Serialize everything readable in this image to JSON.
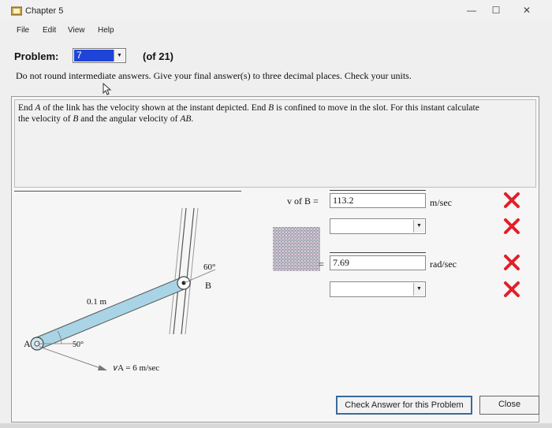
{
  "window": {
    "title": "Chapter 5",
    "controls": {
      "minimize": "—",
      "maximize": "☐",
      "close": "✕"
    }
  },
  "menu": [
    "File",
    "Edit",
    "View",
    "Help"
  ],
  "problem": {
    "label": "Problem:",
    "selected": "7",
    "count": "(of 21)",
    "instructions": "Do not round intermediate answers.  Give your final answer(s) to three decimal places.  Check your units."
  },
  "statement": {
    "line1_parts": [
      "End ",
      "A",
      " of the link has the velocity shown at the instant depicted. End ",
      "B",
      " is confined to move in the slot. For this instant calculate"
    ],
    "line2_parts": [
      "the velocity of ",
      "B",
      " and the angular velocity of ",
      "AB",
      "."
    ]
  },
  "diagram": {
    "label_A": "A",
    "label_B": "B",
    "angle_top": "60°",
    "angle_bottom": "50°",
    "length": "0.1 m",
    "velocity": "𝑣A = 6 m/sec"
  },
  "answers": [
    {
      "label": "v of B =",
      "value": "113.2",
      "units": "m/sec",
      "status": "incorrect"
    },
    {
      "value": "",
      "status": "incorrect"
    },
    {
      "label": "=",
      "value": "7.69",
      "units": "rad/sec",
      "status": "incorrect"
    },
    {
      "value": "",
      "status": "incorrect"
    }
  ],
  "buttons": {
    "check": "Check Answer for this Problem",
    "close": "Close"
  },
  "colors": {
    "incorrect": "#e0202a",
    "selection": "#1f44d8",
    "link": "#a9d4e6"
  }
}
